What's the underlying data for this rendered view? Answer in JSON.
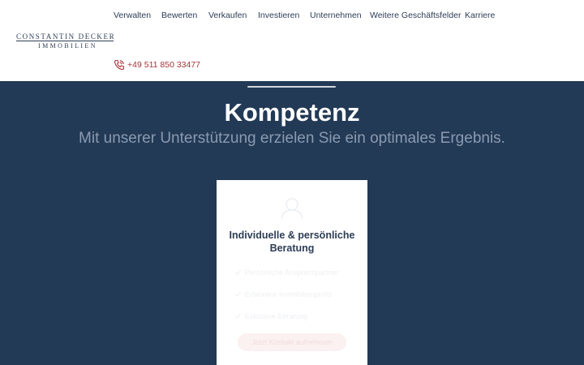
{
  "header": {
    "nav": [
      {
        "label": "Verwalten"
      },
      {
        "label": "Bewerten"
      },
      {
        "label": "Verkaufen"
      },
      {
        "label": "Investieren"
      },
      {
        "label": "Unternehmen"
      },
      {
        "label": "Weitere Geschäftsfelder"
      },
      {
        "label": "Karriere"
      }
    ],
    "logo": {
      "line1": "CONSTANTIN DECKER",
      "line2": "IMMOBILIEN"
    },
    "phone": {
      "icon": "phone-icon",
      "number": "+49 511 850 33477"
    }
  },
  "hero": {
    "title": "Kompetenz",
    "subtitle": "Mit unserer Unterstützung erzielen Sie ein optimales Ergebnis."
  },
  "card": {
    "icon": "people-icon",
    "title_line1": "Individuelle & persönliche",
    "title_line2": "Beratung",
    "items": [
      {
        "label": "Persönliche Ansprechpartner"
      },
      {
        "label": "Erfahrene Immobilienprofis"
      },
      {
        "label": "Exklusive Beratung"
      }
    ],
    "cta": "Jetzt Kontakt aufnehmen"
  },
  "colors": {
    "navy": "#233a56",
    "text_dark": "#2c3d56",
    "accent_red": "#a3343a",
    "subtitle_gray": "#8a9ab0"
  }
}
